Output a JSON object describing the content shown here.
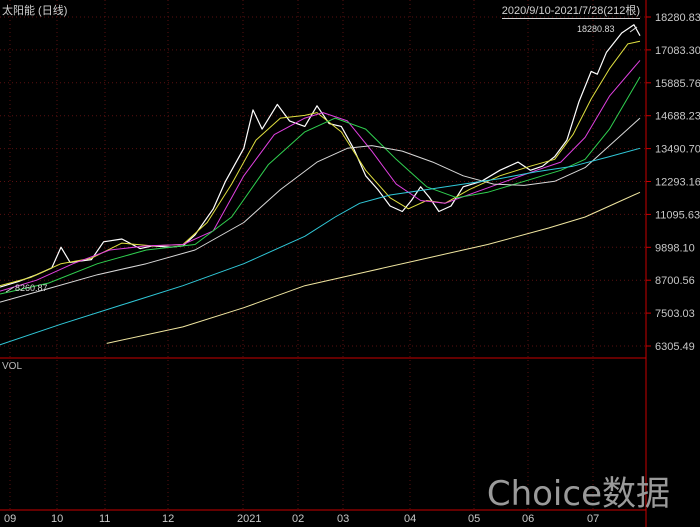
{
  "header": {
    "title": "太阳能 (日线)",
    "range": "2020/9/10-2021/7/28(212根)"
  },
  "volume_label": "VOL",
  "watermark": "Choice数据",
  "annotations": {
    "low": "8260.87",
    "high": "18280.83"
  },
  "chart_data": {
    "type": "line",
    "title": "太阳能 (日线)",
    "xlabel": "",
    "ylabel": "",
    "x_ticks": [
      "09",
      "10",
      "11",
      "12",
      "2021",
      "02",
      "03",
      "04",
      "05",
      "06",
      "07"
    ],
    "y_ticks": [
      "18280.83",
      "17083.30",
      "15885.76",
      "14688.23",
      "13490.70",
      "12293.16",
      "11095.63",
      "9898.10",
      "8700.56",
      "7503.03",
      "6305.49"
    ],
    "ylim": [
      6305.49,
      18280.83
    ],
    "grid": true,
    "series": [
      {
        "color": "#ffffff",
        "values": [
          [
            0,
            8450
          ],
          [
            0.3,
            8650
          ],
          [
            0.6,
            8900
          ],
          [
            0.85,
            9150
          ],
          [
            1.0,
            9900
          ],
          [
            1.15,
            9350
          ],
          [
            1.5,
            9450
          ],
          [
            1.7,
            10100
          ],
          [
            2.0,
            10200
          ],
          [
            2.3,
            9850
          ],
          [
            2.5,
            9950
          ],
          [
            2.8,
            9900
          ],
          [
            3.0,
            9950
          ],
          [
            3.2,
            10350
          ],
          [
            3.5,
            11300
          ],
          [
            3.7,
            12300
          ],
          [
            3.9,
            13100
          ],
          [
            4.0,
            13500
          ],
          [
            4.15,
            14900
          ],
          [
            4.3,
            14200
          ],
          [
            4.55,
            15100
          ],
          [
            4.75,
            14500
          ],
          [
            5.0,
            14300
          ],
          [
            5.2,
            15050
          ],
          [
            5.4,
            14400
          ],
          [
            5.6,
            14300
          ],
          [
            5.8,
            13500
          ],
          [
            6.0,
            12500
          ],
          [
            6.2,
            12000
          ],
          [
            6.4,
            11400
          ],
          [
            6.6,
            11200
          ],
          [
            6.75,
            11600
          ],
          [
            6.9,
            12100
          ],
          [
            7.05,
            11700
          ],
          [
            7.2,
            11200
          ],
          [
            7.4,
            11400
          ],
          [
            7.6,
            12100
          ],
          [
            7.9,
            12300
          ],
          [
            8.2,
            12700
          ],
          [
            8.5,
            13000
          ],
          [
            8.7,
            12700
          ],
          [
            8.9,
            12850
          ],
          [
            9.1,
            13200
          ],
          [
            9.3,
            13800
          ],
          [
            9.5,
            15200
          ],
          [
            9.7,
            16300
          ],
          [
            9.8,
            16200
          ],
          [
            9.95,
            17000
          ],
          [
            10.2,
            17700
          ],
          [
            10.4,
            18000
          ],
          [
            10.5,
            17600
          ]
        ]
      },
      {
        "color": "#e0e040",
        "values": [
          [
            0,
            8500
          ],
          [
            0.5,
            8800
          ],
          [
            1.0,
            9300
          ],
          [
            1.5,
            9500
          ],
          [
            2.0,
            10050
          ],
          [
            2.5,
            9950
          ],
          [
            3.0,
            10000
          ],
          [
            3.4,
            10800
          ],
          [
            3.8,
            12200
          ],
          [
            4.2,
            13800
          ],
          [
            4.6,
            14600
          ],
          [
            5.0,
            14700
          ],
          [
            5.2,
            14800
          ],
          [
            5.6,
            14100
          ],
          [
            6.0,
            12700
          ],
          [
            6.4,
            11700
          ],
          [
            6.7,
            11300
          ],
          [
            7.0,
            11600
          ],
          [
            7.3,
            11500
          ],
          [
            7.7,
            12000
          ],
          [
            8.2,
            12500
          ],
          [
            8.7,
            12850
          ],
          [
            9.1,
            13100
          ],
          [
            9.4,
            14000
          ],
          [
            9.7,
            15300
          ],
          [
            10.0,
            16400
          ],
          [
            10.3,
            17300
          ],
          [
            10.5,
            17400
          ]
        ]
      },
      {
        "color": "#e040e0",
        "values": [
          [
            0,
            8300
          ],
          [
            0.6,
            8700
          ],
          [
            1.2,
            9300
          ],
          [
            1.8,
            9800
          ],
          [
            2.4,
            9950
          ],
          [
            3.0,
            10000
          ],
          [
            3.5,
            10500
          ],
          [
            4.0,
            12500
          ],
          [
            4.5,
            14000
          ],
          [
            5.0,
            14600
          ],
          [
            5.3,
            14800
          ],
          [
            5.7,
            14500
          ],
          [
            6.1,
            13400
          ],
          [
            6.5,
            12200
          ],
          [
            6.9,
            11600
          ],
          [
            7.3,
            11500
          ],
          [
            7.8,
            11900
          ],
          [
            8.3,
            12300
          ],
          [
            8.8,
            12700
          ],
          [
            9.2,
            13000
          ],
          [
            9.6,
            13900
          ],
          [
            10.0,
            15400
          ],
          [
            10.5,
            16700
          ]
        ]
      },
      {
        "color": "#30d050",
        "values": [
          [
            0,
            8200
          ],
          [
            0.8,
            8600
          ],
          [
            1.6,
            9300
          ],
          [
            2.4,
            9800
          ],
          [
            3.2,
            10000
          ],
          [
            3.8,
            11000
          ],
          [
            4.4,
            12900
          ],
          [
            5.0,
            14100
          ],
          [
            5.5,
            14600
          ],
          [
            6.0,
            14200
          ],
          [
            6.5,
            13100
          ],
          [
            7.0,
            12100
          ],
          [
            7.5,
            11700
          ],
          [
            8.0,
            11900
          ],
          [
            8.6,
            12300
          ],
          [
            9.2,
            12700
          ],
          [
            9.6,
            13100
          ],
          [
            10.0,
            14200
          ],
          [
            10.5,
            16100
          ]
        ]
      },
      {
        "color": "#d8d8d8",
        "values": [
          [
            0,
            7900
          ],
          [
            0.8,
            8400
          ],
          [
            1.6,
            8900
          ],
          [
            2.4,
            9300
          ],
          [
            3.2,
            9800
          ],
          [
            4.0,
            10800
          ],
          [
            4.6,
            12000
          ],
          [
            5.2,
            13000
          ],
          [
            5.7,
            13500
          ],
          [
            6.1,
            13600
          ],
          [
            6.6,
            13400
          ],
          [
            7.1,
            13000
          ],
          [
            7.6,
            12500
          ],
          [
            8.1,
            12200
          ],
          [
            8.6,
            12150
          ],
          [
            9.1,
            12300
          ],
          [
            9.6,
            12800
          ],
          [
            10.1,
            13800
          ],
          [
            10.5,
            14600
          ]
        ]
      },
      {
        "color": "#30c8d8",
        "values": [
          [
            0,
            6350
          ],
          [
            1.0,
            7100
          ],
          [
            2.0,
            7800
          ],
          [
            3.0,
            8500
          ],
          [
            4.0,
            9300
          ],
          [
            5.0,
            10300
          ],
          [
            5.5,
            11000
          ],
          [
            5.9,
            11500
          ],
          [
            6.4,
            11800
          ],
          [
            7.0,
            12000
          ],
          [
            7.6,
            12200
          ],
          [
            8.2,
            12400
          ],
          [
            8.8,
            12650
          ],
          [
            9.4,
            12850
          ],
          [
            10.0,
            13200
          ],
          [
            10.5,
            13500
          ]
        ]
      },
      {
        "color": "#f0e6a0",
        "values": [
          [
            1.75,
            6400
          ],
          [
            3.0,
            7000
          ],
          [
            4.0,
            7700
          ],
          [
            5.0,
            8500
          ],
          [
            6.0,
            9000
          ],
          [
            7.0,
            9500
          ],
          [
            8.0,
            10000
          ],
          [
            9.0,
            10600
          ],
          [
            9.6,
            11000
          ],
          [
            10.2,
            11600
          ],
          [
            10.5,
            11900
          ]
        ]
      }
    ]
  }
}
